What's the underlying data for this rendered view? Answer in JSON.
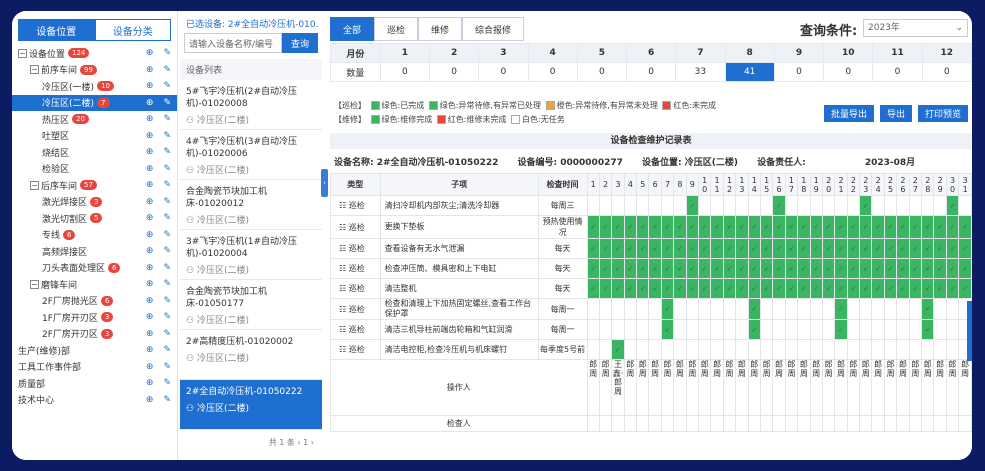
{
  "left": {
    "tabs": [
      "设备位置",
      "设备分类"
    ],
    "tree": [
      {
        "label": "设备位置",
        "count": "124",
        "level": 0,
        "toggle": "−",
        "actions": true
      },
      {
        "label": "前序车间",
        "count": "99",
        "level": 1,
        "toggle": "−",
        "actions": true
      },
      {
        "label": "冷压区(一楼)",
        "count": "10",
        "level": 2,
        "actions": true
      },
      {
        "label": "冷压区(二楼)",
        "count": "7",
        "level": 2,
        "actions": true,
        "selected": true
      },
      {
        "label": "热压区",
        "count": "20",
        "level": 2,
        "actions": true
      },
      {
        "label": "吐塑区",
        "count": "",
        "level": 2,
        "actions": true
      },
      {
        "label": "烧结区",
        "count": "",
        "level": 2,
        "actions": true
      },
      {
        "label": "检验区",
        "count": "",
        "level": 2,
        "actions": true
      },
      {
        "label": "后序车间",
        "count": "57",
        "level": 1,
        "toggle": "−",
        "actions": true
      },
      {
        "label": "激光焊接区",
        "count": "3",
        "level": 2,
        "actions": true
      },
      {
        "label": "激光切割区",
        "count": "5",
        "level": 2,
        "actions": true
      },
      {
        "label": "专线",
        "count": "6",
        "level": 2,
        "actions": true
      },
      {
        "label": "高频焊接区",
        "count": "",
        "level": 2,
        "actions": true
      },
      {
        "label": "刀头表面处理区",
        "count": "6",
        "level": 2,
        "actions": true
      },
      {
        "label": "磨锋车间",
        "count": "",
        "level": 1,
        "toggle": "−",
        "actions": true
      },
      {
        "label": "2F厂房抛光区",
        "count": "6",
        "level": 2,
        "actions": true
      },
      {
        "label": "1F厂房开刃区",
        "count": "3",
        "level": 2,
        "actions": true
      },
      {
        "label": "2F厂房开刃区",
        "count": "3",
        "level": 2,
        "actions": true
      },
      {
        "label": "生产(维修)部",
        "count": "",
        "level": 0,
        "actions": true
      },
      {
        "label": "工具工作事件部",
        "count": "",
        "level": 0,
        "actions": true
      },
      {
        "label": "质量部",
        "count": "",
        "level": 0,
        "actions": true
      },
      {
        "label": "技术中心",
        "count": "",
        "level": 0,
        "actions": true
      }
    ]
  },
  "middle": {
    "selected_label": "已选设备: 2#全自动冷压机-010...",
    "search_placeholder": "请输入设备名称/编号",
    "search_button": "查询",
    "list_header": "设备列表",
    "devices": [
      {
        "name": "5#飞宇冷压机(2#自动冷压机)-01020008",
        "loc": "冷压区(二楼)"
      },
      {
        "name": "4#飞宇冷压机(3#自动冷压机)-01020006",
        "loc": "冷压区(二楼)"
      },
      {
        "name": "合金陶瓷节块加工机床-01020012",
        "loc": "冷压区(二楼)"
      },
      {
        "name": "3#飞宇冷压机(1#自动冷压机)-01020004",
        "loc": "冷压区(二楼)"
      },
      {
        "name": "合金陶瓷节块加工机床-01050177",
        "loc": "冷压区(二楼)"
      },
      {
        "name": "2#高精度压机-01020002",
        "loc": "冷压区(二楼)"
      },
      {
        "name": "2#全自动冷压机-01050222",
        "loc": "冷压区(二楼)",
        "selected": true
      }
    ],
    "pager": "共 1 条  ‹  1  ›"
  },
  "right": {
    "tabs": [
      "全部",
      "巡检",
      "维修",
      "综合报修"
    ],
    "query_label": "查询条件:",
    "year_select": "2023年",
    "month_table": {
      "row1_label": "月份",
      "row2_label": "数量",
      "months": [
        "1",
        "2",
        "3",
        "4",
        "5",
        "6",
        "7",
        "8",
        "9",
        "10",
        "11",
        "12"
      ],
      "counts": [
        "0",
        "0",
        "0",
        "0",
        "0",
        "0",
        "33",
        "41",
        "0",
        "0",
        "0",
        "0"
      ],
      "highlight_month": "8"
    },
    "legend": {
      "line1": [
        {
          "text": "【巡检】",
          "color": ""
        },
        {
          "text": "绿色:已完成",
          "color": "#3bb463"
        },
        {
          "text": "绿色:异常待修,有异常已处理",
          "color": "#3bb463"
        },
        {
          "text": "橙色:异常待修,有异常未处理",
          "color": "#f0a03c"
        },
        {
          "text": "红色:未完成",
          "color": "#e8453c"
        }
      ],
      "line2": [
        {
          "text": "【维修】",
          "color": ""
        },
        {
          "text": "绿色:维修完成",
          "color": "#3bb463"
        },
        {
          "text": "红色:维修未完成",
          "color": "#e8453c"
        },
        {
          "text": "白色:无任务",
          "color": "#ffffff"
        }
      ],
      "no_task": "白色:无任务"
    },
    "buttons": [
      "批量导出",
      "导出",
      "打印预览"
    ],
    "record_title": "设备检查维护记录表",
    "info": {
      "name": "设备名称: 2#全自动冷压机-01050222",
      "code": "设备编号: 0000000277",
      "location": "设备位置: 冷压区(二楼)",
      "owner": "设备责任人:",
      "date": "2023-08月"
    },
    "grid_headers": {
      "type": "类型",
      "item": "子项",
      "freq": "检查时间"
    },
    "days": [
      "1",
      "2",
      "3",
      "4",
      "5",
      "6",
      "7",
      "8",
      "9",
      "10",
      "11",
      "12",
      "13",
      "14",
      "15",
      "16",
      "17",
      "18",
      "19",
      "20",
      "21",
      "22",
      "23",
      "24",
      "25",
      "26",
      "27",
      "28",
      "29",
      "30",
      "31"
    ],
    "rows": [
      {
        "type": "巡检",
        "item": "清扫冷却机内部灰尘;清洗冷却器",
        "freq": "每周三",
        "done": [
          9,
          16,
          23,
          30
        ]
      },
      {
        "type": "巡检",
        "item": "更换下垫板",
        "freq": "预热使用情况",
        "done": [
          1,
          2,
          3,
          4,
          5,
          6,
          7,
          8,
          9,
          10,
          11,
          12,
          13,
          14,
          15,
          16,
          17,
          18,
          19,
          20,
          21,
          22,
          23,
          24,
          25,
          26,
          27,
          28,
          29,
          30,
          31
        ]
      },
      {
        "type": "巡检",
        "item": "查看设备有无水气泄漏",
        "freq": "每天",
        "done": [
          1,
          2,
          3,
          4,
          5,
          6,
          7,
          8,
          9,
          10,
          11,
          12,
          13,
          14,
          15,
          16,
          17,
          18,
          19,
          20,
          21,
          22,
          23,
          24,
          25,
          26,
          27,
          28,
          29,
          30,
          31
        ]
      },
      {
        "type": "巡检",
        "item": "检查冲压筒、模具密和上下电缸",
        "freq": "每天",
        "done": [
          1,
          2,
          3,
          4,
          5,
          6,
          7,
          8,
          9,
          10,
          11,
          12,
          13,
          14,
          15,
          16,
          17,
          18,
          19,
          20,
          21,
          22,
          23,
          24,
          25,
          26,
          27,
          28,
          29,
          30,
          31
        ]
      },
      {
        "type": "巡检",
        "item": "清洁整机",
        "freq": "每天",
        "done": [
          1,
          2,
          3,
          4,
          5,
          6,
          7,
          8,
          9,
          10,
          11,
          12,
          13,
          14,
          15,
          16,
          17,
          18,
          19,
          20,
          21,
          22,
          23,
          24,
          25,
          26,
          27,
          28,
          29,
          30,
          31
        ]
      },
      {
        "type": "巡检",
        "item": "检查和清理上下加热固定螺丝,查看工作台保护罩",
        "freq": "每周一",
        "done": [
          7,
          14,
          21,
          28
        ]
      },
      {
        "type": "巡检",
        "item": "清洁三机导柱前端齿轮箱和气缸润滑",
        "freq": "每周一",
        "done": [
          7,
          14,
          21,
          28
        ]
      },
      {
        "type": "巡检",
        "item": "清洁电控柜,检查冷压机与机床螺钉",
        "freq": "每季度5号前",
        "done": [
          3
        ]
      }
    ],
    "operator_label": "操作人",
    "checker_label": "检查人",
    "operator_names": {
      "1": "郎周",
      "2": "郎周",
      "3": "王鑫·郎周",
      "4": "郎周",
      "5": "郎周",
      "6": "郎周",
      "7": "郎周",
      "8": "郎周",
      "9": "郎周",
      "10": "郎周",
      "11": "郎周",
      "12": "郎周",
      "13": "郎周",
      "14": "郎周",
      "15": "郎周",
      "16": "郎周",
      "17": "郎周",
      "18": "郎周",
      "19": "郎周",
      "20": "郎周",
      "21": "郎周",
      "22": "郎周",
      "23": "郎周",
      "24": "郎周",
      "25": "郎周",
      "26": "郎周",
      "27": "郎周",
      "28": "郎周",
      "29": "郎周",
      "30": "郎周",
      "31": "郎周"
    }
  },
  "colors": {
    "accent": "#1f6fd1",
    "done": "#3bb463",
    "badge": "#e8453c",
    "bezel": "#0d1b63"
  }
}
